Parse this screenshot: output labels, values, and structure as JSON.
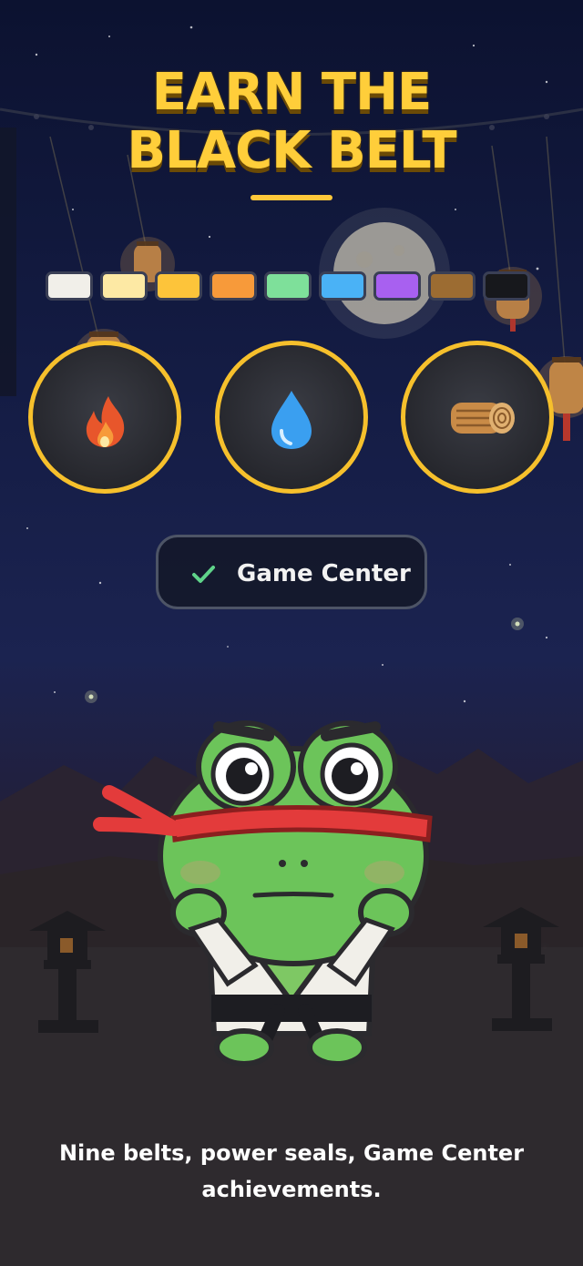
{
  "title": {
    "line1": "EARN THE",
    "line2": "BLACK BELT"
  },
  "belts": [
    {
      "name": "white-belt",
      "color": "#f1efe9"
    },
    {
      "name": "cream-belt",
      "color": "#fde9a4"
    },
    {
      "name": "yellow-belt",
      "color": "#fdc43a"
    },
    {
      "name": "orange-belt",
      "color": "#f79a3a"
    },
    {
      "name": "green-belt",
      "color": "#7ee09a"
    },
    {
      "name": "blue-belt",
      "color": "#4ab2f6"
    },
    {
      "name": "purple-belt",
      "color": "#a860f0"
    },
    {
      "name": "brown-belt",
      "color": "#9c6c32"
    },
    {
      "name": "black-belt",
      "color": "#17181c"
    }
  ],
  "seals": [
    {
      "name": "fire-icon"
    },
    {
      "name": "water-drop-icon"
    },
    {
      "name": "log-icon"
    }
  ],
  "game_center": {
    "label": "Game Center",
    "check_color": "#5fd38a"
  },
  "caption": {
    "line1": "Nine belts, power seals, Game Center",
    "line2": "achievements."
  },
  "colors": {
    "accent": "#ffce3a",
    "seal_ring": "#f6c02c"
  }
}
